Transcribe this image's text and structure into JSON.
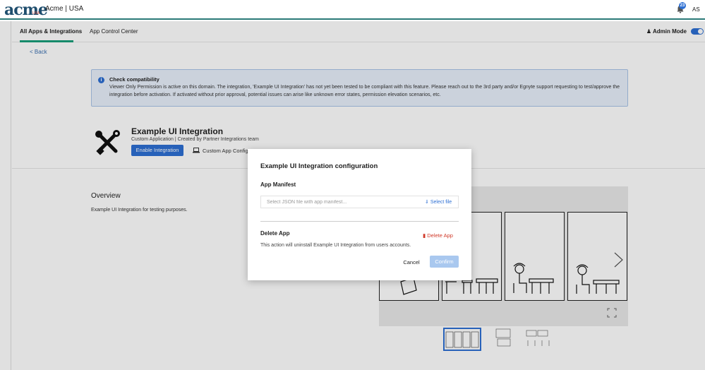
{
  "header": {
    "logo": "acme",
    "logo_sub": "USA",
    "tenant": "Acme | USA",
    "notification_count": "23",
    "user_initials": "AS"
  },
  "tabs": [
    {
      "label": "All Apps & Integrations",
      "active": true
    },
    {
      "label": "App Control Center",
      "active": false
    }
  ],
  "admin_mode": {
    "label": "Admin Mode",
    "enabled": true
  },
  "back_label": "< Back",
  "alert": {
    "title": "Check compatibility",
    "body": "Viewer Only Permission is active on this domain. The integration, 'Example UI Integration' has not yet been tested to be compliant with this feature. Please reach out to the 3rd party and/or Egnyte support requesting to test/approve the integration before activation. If activated without prior approval, potential issues can arise like unknown error states, permission elevation scenarios, etc."
  },
  "integration": {
    "title": "Example UI Integration",
    "subtitle": "Custom Application | Created by Partner Integrations team",
    "enable_label": "Enable Integration",
    "custom_config_label": "Custom App Config"
  },
  "overview": {
    "title": "Overview",
    "text": "Example UI Integration for testing purposes."
  },
  "modal": {
    "title": "Example UI Integration configuration",
    "manifest_label": "App Manifest",
    "manifest_placeholder": "Select JSON file with app manifest...",
    "select_file_label": "Select file",
    "delete_section_label": "Delete App",
    "delete_app_label": "Delete App",
    "delete_description": "This action will uninstall Example UI Integration from users accounts.",
    "cancel_label": "Cancel",
    "confirm_label": "Confirm"
  },
  "colors": {
    "primary": "#2d6fd3",
    "accent_green": "#1a9e7a",
    "danger": "#d03a2a",
    "confirm_disabled": "#a9c8ef"
  }
}
